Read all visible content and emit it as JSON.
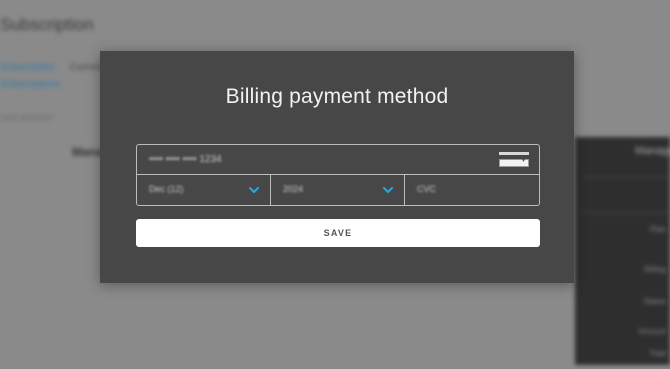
{
  "background": {
    "page_title": "Subscription",
    "link_1": "Subscription",
    "link_2": "Subscriptions",
    "tab": "Current",
    "meta": "Last updated",
    "heading": "Manage",
    "panel_title": "Manage",
    "panel_lines": [
      "Plan",
      "Billing",
      "Status",
      "Amount",
      "Total"
    ]
  },
  "modal": {
    "title": "Billing payment method",
    "card_number_placeholder": "•••• •••• •••• 1234",
    "expiry_month": "Dec (12)",
    "expiry_year": "2024",
    "cvc_placeholder": "CVC",
    "save_label": "SAVE"
  },
  "colors": {
    "accent": "#29a8e0",
    "modal_bg": "#474747",
    "button_bg": "#ffffff"
  },
  "icons": {
    "month_select": "chevron-down-icon",
    "year_select": "chevron-down-icon"
  }
}
